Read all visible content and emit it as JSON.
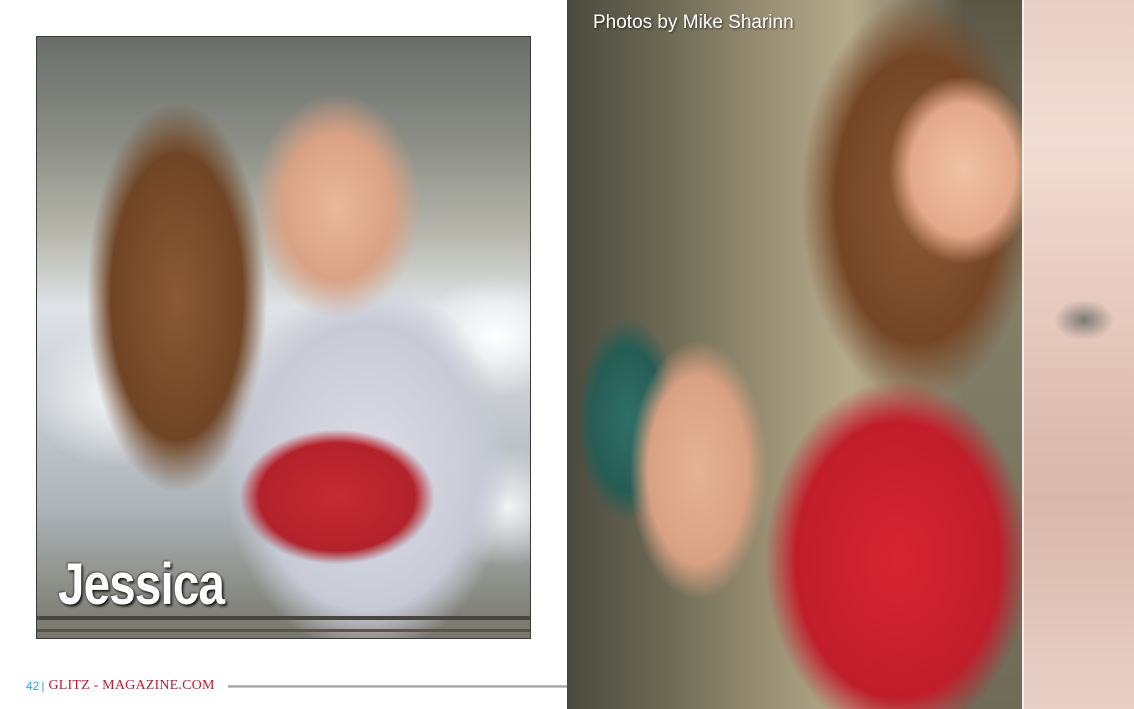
{
  "left_page": {
    "model_name": "Jessica",
    "footer": {
      "page_number": "42",
      "separator": "|",
      "site_name": "GLITZ - MAGAZINE.COM"
    }
  },
  "right_page": {
    "photo_credit": "Photos by Mike Sharinn"
  },
  "colors": {
    "page_number": "#3aa7d8",
    "site_name": "#c8172f",
    "dress_red": "#c52a32"
  }
}
